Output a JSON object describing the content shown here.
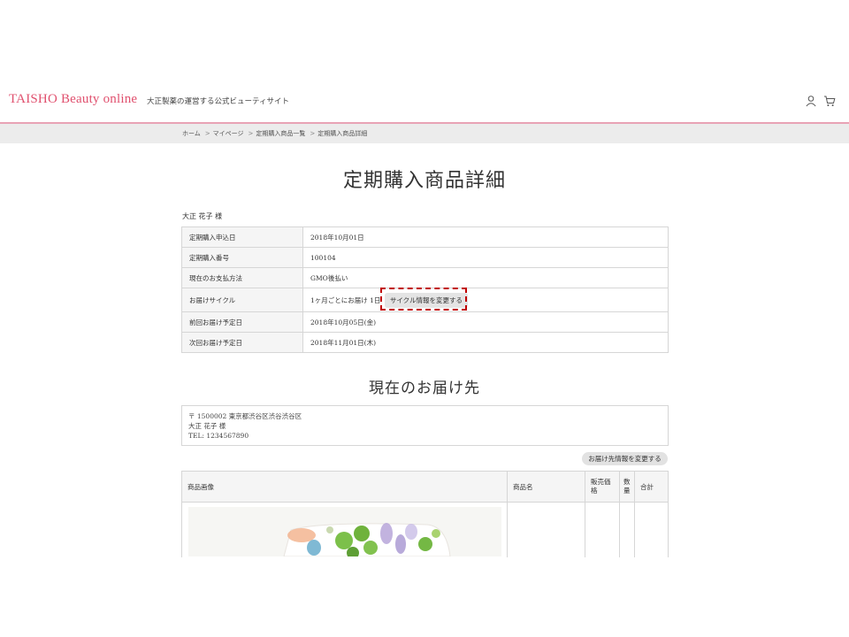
{
  "header": {
    "logo": "TAISHO Beauty online",
    "tagline": "大正製薬の運営する公式ビューティサイト",
    "icons": [
      "user-icon",
      "cart-icon"
    ]
  },
  "breadcrumb": [
    "ホーム",
    "マイページ",
    "定期購入商品一覧",
    "定期購入商品詳細"
  ],
  "page_title": "定期購入商品詳細",
  "customer_name": "大正 花子 様",
  "details": [
    {
      "label": "定期購入申込日",
      "value": "2018年10月01日"
    },
    {
      "label": "定期購入番号",
      "value": "100104"
    },
    {
      "label": "現在のお支払方法",
      "value": "GMO後払い"
    },
    {
      "label": "お届けサイクル",
      "value": "1ヶ月ごとにお届け 1日",
      "button": "サイクル情報を変更する"
    },
    {
      "label": "前回お届け予定日",
      "value": "2018年10月05日(金)"
    },
    {
      "label": "次回お届け予定日",
      "value": "2018年11月01日(木)"
    }
  ],
  "delivery": {
    "title": "現在のお届け先",
    "postal_line": "〒 1500002 東京都渋谷区渋谷渋谷区",
    "name": "大正 花子 様",
    "tel": "TEL: 1234567890",
    "change_button": "お届け先情報を変更する"
  },
  "products_table": {
    "headers": [
      "商品画像",
      "商品名",
      "販売価格",
      "数量",
      "合計"
    ]
  },
  "colors": {
    "brand": "#e0506e",
    "header_rule": "#e8a3b5",
    "highlight": "#c00000",
    "crumb_bar": "#ececec"
  }
}
